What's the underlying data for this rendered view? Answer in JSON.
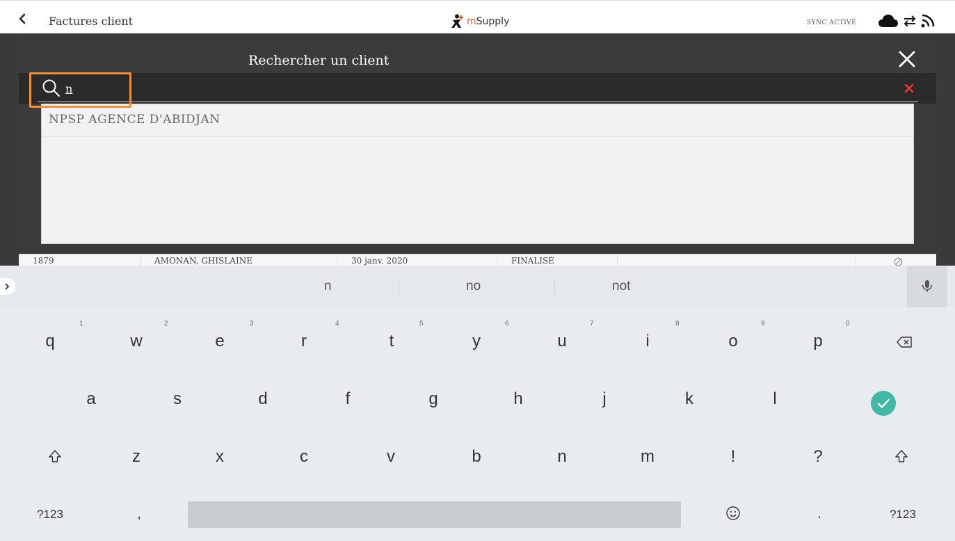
{
  "topbar": {
    "title": "Factures client",
    "logo_m": "m",
    "logo_rest": "Supply",
    "sync_status": "SYNC ACTIVÉ"
  },
  "modal": {
    "title": "Rechercher un client",
    "search": {
      "value": "n",
      "placeholder": ""
    },
    "results": [
      "NPSP AGENCE D'ABIDJAN"
    ]
  },
  "background_row": {
    "cells": [
      "1879",
      "AMONAN, GHISLAINE",
      "30 janv. 2020",
      "FINALISÉ",
      ""
    ]
  },
  "keyboard": {
    "suggestions": [
      "n",
      "no",
      "not"
    ],
    "row1": [
      "q",
      "w",
      "e",
      "r",
      "t",
      "y",
      "u",
      "i",
      "o",
      "p"
    ],
    "row1_hints": [
      "1",
      "2",
      "3",
      "4",
      "5",
      "6",
      "7",
      "8",
      "9",
      "0"
    ],
    "row2": [
      "a",
      "s",
      "d",
      "f",
      "g",
      "h",
      "j",
      "k",
      "l"
    ],
    "row3": [
      "z",
      "x",
      "c",
      "v",
      "b",
      "n",
      "m",
      "!",
      "?"
    ],
    "bottom": {
      "symbols_left": "?123",
      "comma": ",",
      "period": ".",
      "symbols_right": "?123"
    }
  },
  "colors": {
    "accent_orange": "#f0913a",
    "clear_red": "#e53935",
    "enter_teal": "#41b9a6",
    "logo_orange": "#e95c30"
  }
}
